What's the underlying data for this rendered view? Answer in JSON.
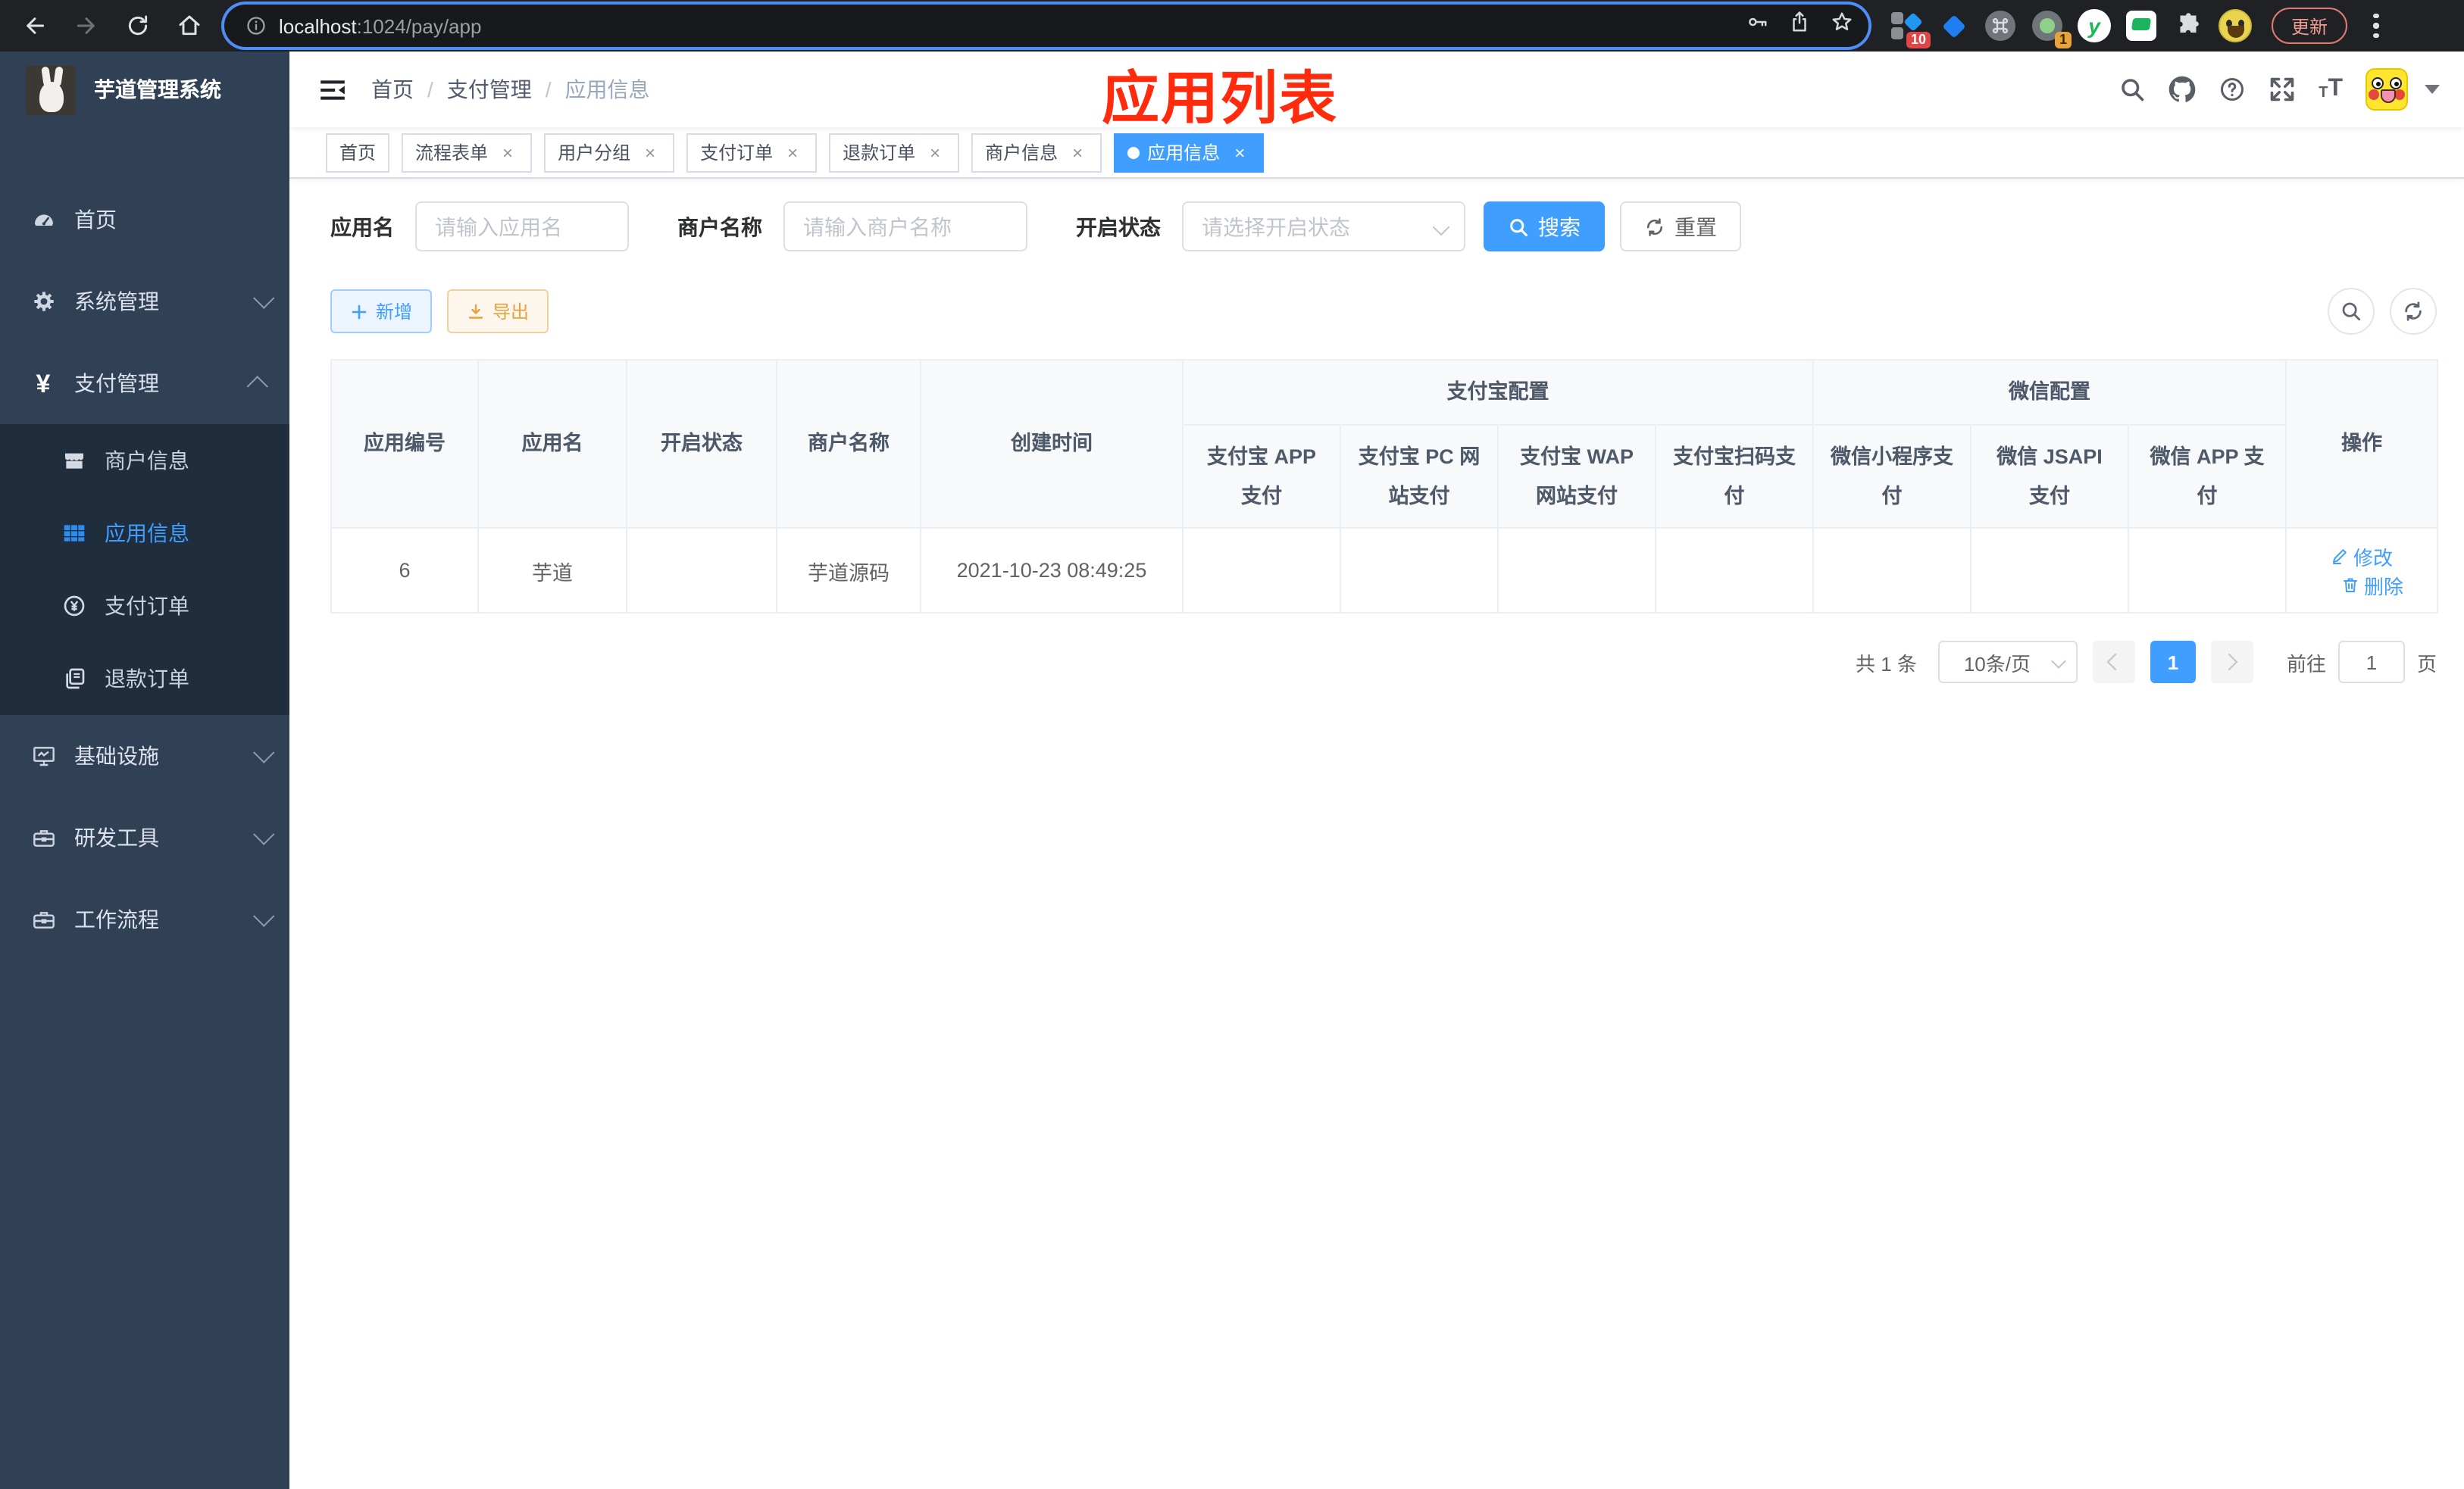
{
  "browser": {
    "url_host": "localhost",
    "url_rest": ":1024/pay/app",
    "extensions": {
      "badge_count_1": "10",
      "badge_count_2": "1",
      "yuque_letter": "y"
    },
    "update_label": "更新"
  },
  "sidebar": {
    "title": "芋道管理系统",
    "menu": [
      {
        "label": "首页",
        "icon": "dashboard-icon"
      },
      {
        "label": "系统管理",
        "icon": "gear-icon"
      },
      {
        "label": "支付管理",
        "icon": "yen-icon"
      },
      {
        "label": "基础设施",
        "icon": "monitor-icon"
      },
      {
        "label": "研发工具",
        "icon": "toolbox-icon"
      },
      {
        "label": "工作流程",
        "icon": "workflow-icon"
      }
    ],
    "submenu": [
      {
        "label": "商户信息",
        "icon": "shop-icon"
      },
      {
        "label": "应用信息",
        "icon": "grid-icon",
        "active": true
      },
      {
        "label": "支付订单",
        "icon": "pay-order-icon"
      },
      {
        "label": "退款订单",
        "icon": "refund-order-icon"
      }
    ]
  },
  "navbar": {
    "breadcrumb": [
      {
        "label": "首页"
      },
      {
        "label": "支付管理"
      },
      {
        "label": "应用信息"
      }
    ],
    "separator": "/"
  },
  "annotation": "应用列表",
  "tabs": [
    {
      "label": "首页",
      "closable": false,
      "active": false
    },
    {
      "label": "流程表单",
      "closable": true,
      "active": false
    },
    {
      "label": "用户分组",
      "closable": true,
      "active": false
    },
    {
      "label": "支付订单",
      "closable": true,
      "active": false
    },
    {
      "label": "退款订单",
      "closable": true,
      "active": false
    },
    {
      "label": "商户信息",
      "closable": true,
      "active": false
    },
    {
      "label": "应用信息",
      "closable": true,
      "active": true
    }
  ],
  "filters": {
    "app_name_label": "应用名",
    "app_name_placeholder": "请输入应用名",
    "merchant_label": "商户名称",
    "merchant_placeholder": "请输入商户名称",
    "status_label": "开启状态",
    "status_placeholder": "请选择开启状态",
    "search_label": "搜索",
    "reset_label": "重置"
  },
  "toolbar": {
    "add_label": "新增",
    "export_label": "导出"
  },
  "table": {
    "columns": [
      "应用编号",
      "应用名",
      "开启状态",
      "商户名称",
      "创建时间"
    ],
    "groups": [
      {
        "label": "支付宝配置",
        "children": [
          "支付宝 APP 支付",
          "支付宝 PC 网站支付",
          "支付宝 WAP 网站支付",
          "支付宝扫码支付"
        ]
      },
      {
        "label": "微信配置",
        "children": [
          "微信小程序支付",
          "微信 JSAPI 支付",
          "微信 APP 支付"
        ]
      }
    ],
    "op_label": "操作",
    "rows": [
      {
        "app_id": "6",
        "app_name": "芋道",
        "status_on": true,
        "merchant_name": "芋道源码",
        "create_time": "2021-10-23 08:49:25",
        "configs": [
          false,
          false,
          false,
          false,
          false,
          true,
          false
        ],
        "edit_label": "修改",
        "delete_label": "删除"
      }
    ]
  },
  "pagination": {
    "total_label": "共 1 条",
    "page_size_label": "10条/页",
    "current_page": "1",
    "goto_label": "前往",
    "goto_value": "1",
    "page_unit": "页"
  },
  "colors": {
    "accent": "#409eff",
    "sidebar_bg": "#304156",
    "submenu_bg": "#1f2d3d",
    "config_off": "#f45056",
    "config_on": "#21c45d",
    "annotation_red": "#ff2b0c"
  }
}
